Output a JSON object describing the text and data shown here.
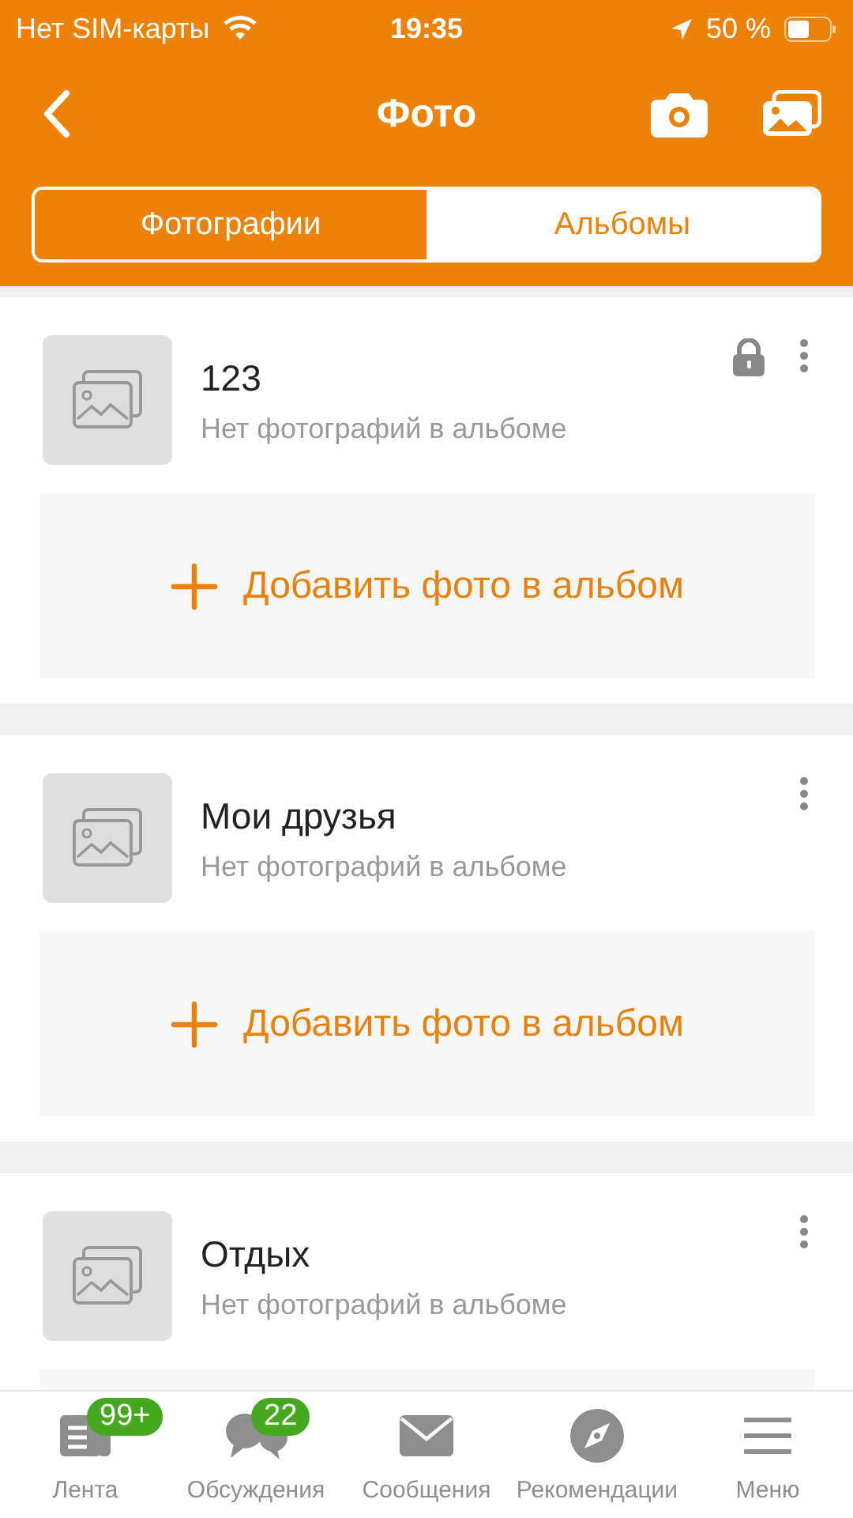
{
  "status_bar": {
    "carrier": "Нет SIM-карты",
    "time": "19:35",
    "battery": "50 %"
  },
  "nav": {
    "title": "Фото"
  },
  "tabs": [
    {
      "label": "Фотографии",
      "selected": false
    },
    {
      "label": "Альбомы",
      "selected": true
    }
  ],
  "albums": [
    {
      "title": "123",
      "subtitle": "Нет фотографий в альбоме",
      "locked": true,
      "add_label": "Добавить фото в альбом"
    },
    {
      "title": "Мои друзья",
      "subtitle": "Нет фотографий в альбоме",
      "locked": false,
      "add_label": "Добавить фото в альбом"
    },
    {
      "title": "Отдых",
      "subtitle": "Нет фотографий в альбоме",
      "locked": false
    }
  ],
  "tab_bar": [
    {
      "kind": "feed",
      "label": "Лента",
      "badge": "99+"
    },
    {
      "kind": "chat",
      "label": "Обсуждения",
      "badge": "22"
    },
    {
      "kind": "mail",
      "label": "Сообщения"
    },
    {
      "kind": "compass",
      "label": "Рекомендации"
    },
    {
      "kind": "menu",
      "label": "Меню"
    }
  ]
}
